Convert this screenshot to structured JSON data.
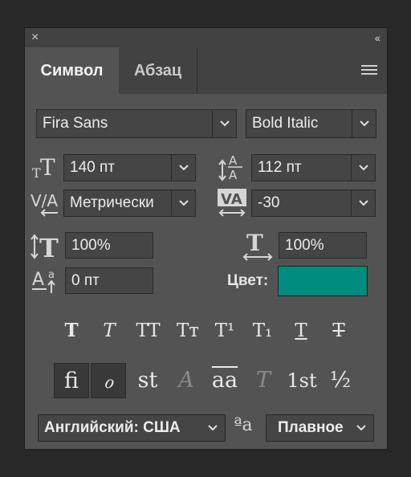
{
  "panel": {
    "close_icon": "×",
    "collapse_icon": "‹‹",
    "tabs": [
      {
        "label": "Символ"
      },
      {
        "label": "Абзац"
      }
    ]
  },
  "font": {
    "family": "Fira Sans",
    "style": "Bold Italic"
  },
  "metrics": {
    "size": "140 пт",
    "leading": "112 пт",
    "kerning": "Метрически",
    "tracking": "-30",
    "vertical_scale": "100%",
    "horizontal_scale": "100%",
    "baseline_shift": "0 пт",
    "color_label": "Цвет:",
    "color_value": "#008c7e"
  },
  "style_buttons": [
    {
      "glyph": "T"
    },
    {
      "glyph": "T"
    },
    {
      "glyph": "TT"
    },
    {
      "glyph": "Tт"
    },
    {
      "glyph": "T¹"
    },
    {
      "glyph": "T₁"
    },
    {
      "glyph": "T"
    },
    {
      "glyph": "T"
    }
  ],
  "opentype_buttons": [
    {
      "glyph": "fi"
    },
    {
      "glyph": "ℴ"
    },
    {
      "glyph": "st"
    },
    {
      "glyph": "A"
    },
    {
      "glyph": "aa"
    },
    {
      "glyph": "T"
    },
    {
      "glyph": "1st"
    },
    {
      "glyph": "½"
    }
  ],
  "footer": {
    "language": "Английский: США",
    "aa_icon": "ªa",
    "antialias": "Плавное"
  }
}
